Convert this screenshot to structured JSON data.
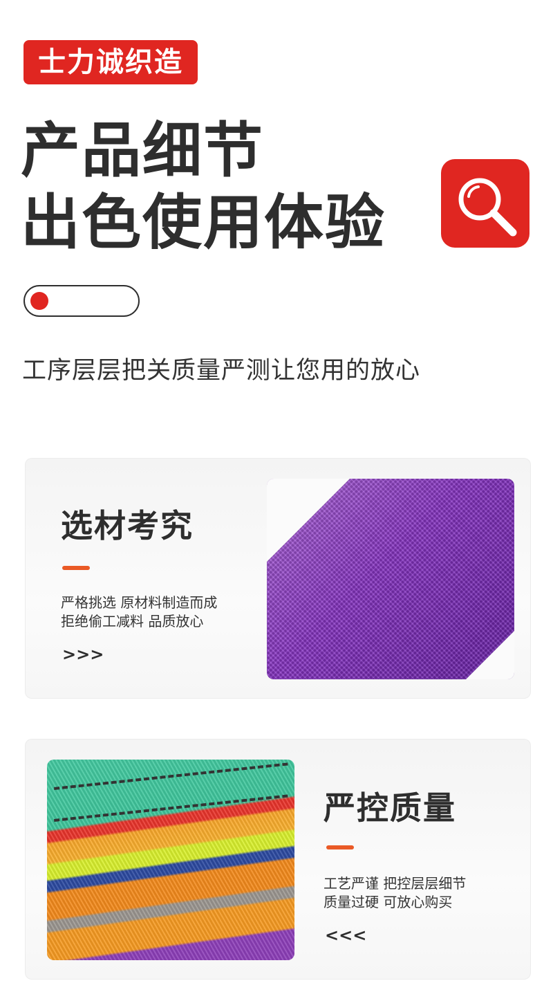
{
  "brand": {
    "label": "士力诚织造"
  },
  "hero": {
    "line1": "产品细节",
    "line2": "出色使用体验",
    "search_icon": "magnifier-icon",
    "accent_color": "#e02621"
  },
  "subtitle": "工序层层把关质量严测让您用的放心",
  "cards": [
    {
      "title": "选材考究",
      "body_line1": "严格挑选 原材料制造而成",
      "body_line2": "拒绝偷工减料 品质放心",
      "chevrons": ">>>",
      "image": "purple-webbing-closeup"
    },
    {
      "title": "严控质量",
      "body_line1": "工艺严谨 把控层层细节",
      "body_line2": "质量过硬 可放心购买",
      "chevrons": "<<<",
      "image": "stacked-colorful-webbing"
    }
  ],
  "colors": {
    "brand_red": "#e02621",
    "accent_orange": "#ea5a26",
    "text_dark": "#2e2e2e"
  }
}
